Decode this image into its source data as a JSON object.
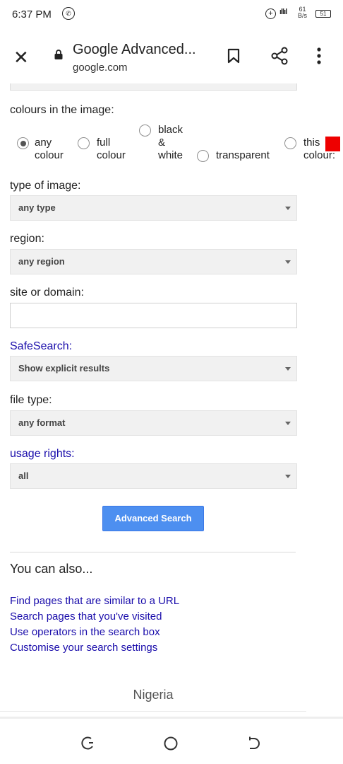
{
  "status_bar": {
    "time": "6:37 PM",
    "speed_top": "61",
    "speed_bottom": "B/s",
    "battery": "51"
  },
  "toolbar": {
    "title": "Google Advanced...",
    "domain": "google.com"
  },
  "form": {
    "colours_label": "colours in the image:",
    "colour_options": {
      "any_line1": "any",
      "any_line2": "colour",
      "full_line1": "full",
      "full_line2": "colour",
      "bw_line1": "black",
      "bw_line2": "&",
      "bw_line3": "white",
      "transparent": "transparent",
      "this_line1": "this",
      "this_line2": "colour:"
    },
    "swatch_color": "#ee0000",
    "type_label": "type of image:",
    "type_value": "any type",
    "region_label": "region:",
    "region_value": "any region",
    "site_label": "site or domain:",
    "site_value": "",
    "safesearch_label": "SafeSearch:",
    "safesearch_value": "Show explicit results",
    "filetype_label": "file type:",
    "filetype_value": "any format",
    "usage_label": "usage rights:",
    "usage_value": "all",
    "search_button": "Advanced Search"
  },
  "also": {
    "heading": "You can also...",
    "links": [
      "Find pages that are similar to a URL",
      "Search pages that you've visited",
      "Use operators in the search box",
      "Customise your search settings"
    ]
  },
  "footer": {
    "country": "Nigeria"
  },
  "colors": {
    "link": "#1a0dab",
    "button": "#4d8ff0"
  }
}
